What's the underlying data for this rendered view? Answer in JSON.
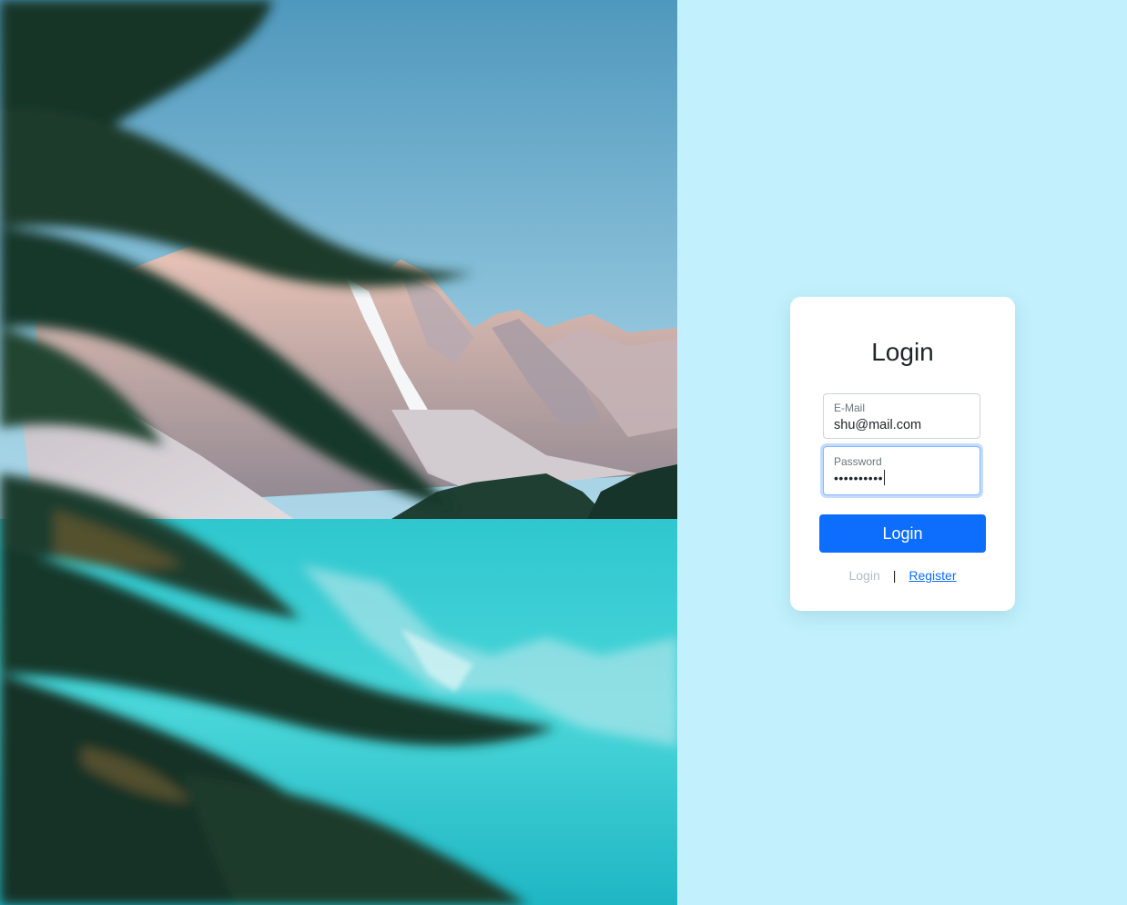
{
  "hero": {
    "image_description": "mountain-lake-with-pine-branches"
  },
  "login_card": {
    "title": "Login",
    "email": {
      "label": "E-Mail",
      "value": "shu@mail.com"
    },
    "password": {
      "label": "Password",
      "value": "••••••••••"
    },
    "submit_label": "Login",
    "links": {
      "login": "Login",
      "separator": "|",
      "register": "Register"
    }
  },
  "colors": {
    "right_background": "#c2f1fd",
    "primary": "#0d6efd",
    "card_background": "#ffffff"
  }
}
